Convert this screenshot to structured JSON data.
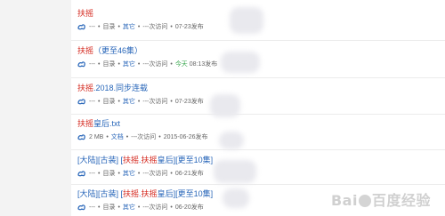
{
  "results": [
    {
      "segments": [
        {
          "text": "扶摇",
          "hl": true
        }
      ],
      "meta": [
        "---",
        "目录",
        "其它",
        "---次访问",
        "07-23发布"
      ],
      "meta_styles": [
        "plain",
        "plain",
        "blue",
        "plain",
        "plain"
      ]
    },
    {
      "segments": [
        {
          "text": "扶摇",
          "hl": true
        },
        {
          "text": "（更至46集）",
          "hl": false
        }
      ],
      "meta": [
        "---",
        "目录",
        "其它",
        "---次访问",
        "今天",
        "08:13发布"
      ],
      "meta_styles": [
        "plain",
        "plain",
        "blue",
        "plain",
        "green",
        "plain"
      ]
    },
    {
      "segments": [
        {
          "text": "扶摇",
          "hl": true
        },
        {
          "text": ".2018.同步连载",
          "hl": false
        }
      ],
      "meta": [
        "---",
        "目录",
        "其它",
        "---次访问",
        "07-23发布"
      ],
      "meta_styles": [
        "plain",
        "plain",
        "blue",
        "plain",
        "plain"
      ]
    },
    {
      "segments": [
        {
          "text": "扶摇",
          "hl": true
        },
        {
          "text": "皇后.txt",
          "hl": false
        }
      ],
      "meta": [
        "2 MB",
        "文档",
        "---次访问",
        "2015-06-26发布"
      ],
      "meta_styles": [
        "plain",
        "blue",
        "plain",
        "plain"
      ]
    },
    {
      "segments": [
        {
          "text": "[大陆][古装] [",
          "hl": false
        },
        {
          "text": "扶摇",
          "hl": true
        },
        {
          "text": ".",
          "hl": false
        },
        {
          "text": "扶摇",
          "hl": true
        },
        {
          "text": "皇后][更至10集]",
          "hl": false
        }
      ],
      "meta": [
        "---",
        "目录",
        "其它",
        "---次访问",
        "06-21发布"
      ],
      "meta_styles": [
        "plain",
        "plain",
        "blue",
        "plain",
        "plain"
      ]
    },
    {
      "segments": [
        {
          "text": "[大陆][古装] [",
          "hl": false
        },
        {
          "text": "扶摇",
          "hl": true
        },
        {
          "text": ".",
          "hl": false
        },
        {
          "text": "扶摇",
          "hl": true
        },
        {
          "text": "皇后][更至10集]",
          "hl": false
        }
      ],
      "meta": [
        "---",
        "目录",
        "其它",
        "---次访问",
        "06-20发布"
      ],
      "meta_styles": [
        "plain",
        "plain",
        "blue",
        "plain",
        "plain"
      ]
    }
  ],
  "watermark": {
    "brand_a": "Bai",
    "brand_b": "百度",
    "suffix": "经验"
  },
  "colors": {
    "link": "#2866b9",
    "highlight": "#d4271d",
    "today": "#36a64b",
    "meta": "#666666"
  },
  "icons": {
    "result": "cloud-share-icon"
  }
}
